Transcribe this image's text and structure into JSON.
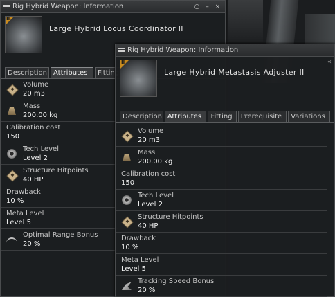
{
  "window1": {
    "title": "Rig Hybrid Weapon: Information",
    "item_name": "Large Hybrid Locus Coordinator II",
    "tech_badge": "II",
    "tabs": [
      "Description",
      "Attributes",
      "Fitting"
    ],
    "active_tab": 1,
    "attributes": [
      {
        "label": "Volume",
        "value": "20 m3",
        "icon": "cargo-box-icon"
      },
      {
        "label": "Mass",
        "value": "200.00 kg",
        "icon": "weight-icon"
      },
      {
        "label": "Calibration cost",
        "value": "150",
        "icon": ""
      },
      {
        "label": "Tech Level",
        "value": "Level 2",
        "icon": "tech-gear-icon"
      },
      {
        "label": "Structure Hitpoints",
        "value": "40 HP",
        "icon": "cargo-box-icon"
      },
      {
        "label": "Drawback",
        "value": "10 %",
        "icon": ""
      },
      {
        "label": "Meta Level",
        "value": "Level 5",
        "icon": ""
      },
      {
        "label": "Optimal Range Bonus",
        "value": "20 %",
        "icon": "optimal-range-icon"
      }
    ]
  },
  "window2": {
    "title": "Rig Hybrid Weapon: Information",
    "item_name": "Large Hybrid Metastasis Adjuster II",
    "tech_badge": "II",
    "tabs": [
      "Description",
      "Attributes",
      "Fitting",
      "Prerequisite",
      "Variations"
    ],
    "active_tab": 1,
    "attributes": [
      {
        "label": "Volume",
        "value": "20 m3",
        "icon": "cargo-box-icon"
      },
      {
        "label": "Mass",
        "value": "200.00 kg",
        "icon": "weight-icon"
      },
      {
        "label": "Calibration cost",
        "value": "150",
        "icon": ""
      },
      {
        "label": "Tech Level",
        "value": "Level 2",
        "icon": "tech-gear-icon"
      },
      {
        "label": "Structure Hitpoints",
        "value": "40 HP",
        "icon": "cargo-box-icon"
      },
      {
        "label": "Drawback",
        "value": "10 %",
        "icon": ""
      },
      {
        "label": "Meta Level",
        "value": "Level 5",
        "icon": ""
      },
      {
        "label": "Tracking Speed Bonus",
        "value": "20 %",
        "icon": "tracking-speed-icon"
      }
    ]
  },
  "controls": {
    "close": "×",
    "minimize": "–",
    "pin": "○",
    "collapse": "«"
  }
}
